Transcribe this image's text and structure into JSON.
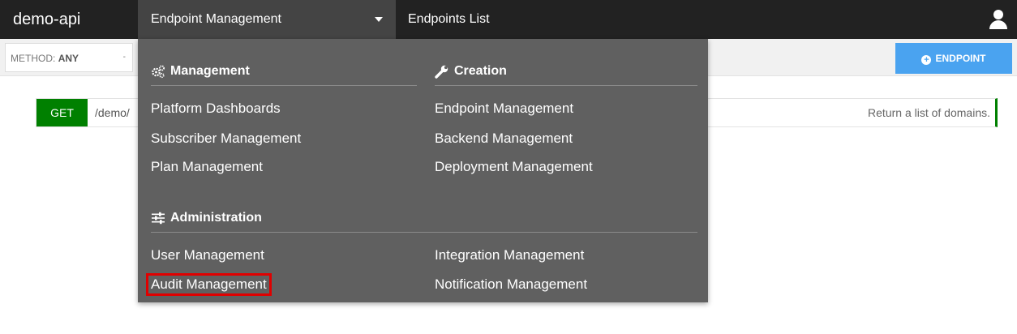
{
  "app": {
    "title": "demo-api"
  },
  "nav": {
    "dropdown_label": "Endpoint Management",
    "breadcrumb": "Endpoints List"
  },
  "toolbar": {
    "method_prefix": "METHOD:",
    "method_value": "ANY",
    "method_caret": "-",
    "endpoint_button": "ENDPOINT"
  },
  "endpoint": {
    "method": "GET",
    "path": "/demo/",
    "description": "Return a list of domains."
  },
  "menu": {
    "management": {
      "title": "Management",
      "items": [
        "Platform Dashboards",
        "Subscriber Management",
        "Plan Management"
      ]
    },
    "creation": {
      "title": "Creation",
      "items": [
        "Endpoint Management",
        "Backend Management",
        "Deployment Management"
      ]
    },
    "administration": {
      "title": "Administration",
      "left_items": [
        "User Management",
        "Audit Management"
      ],
      "right_items": [
        "Integration Management",
        "Notification Management"
      ]
    }
  },
  "colors": {
    "topbar": "#222222",
    "menu_bg": "#606060",
    "accent_blue": "#4aa3f0",
    "get_green": "#008000",
    "highlight_red": "#e00000"
  },
  "icons": [
    "user-icon",
    "cogs-icon",
    "wrench-icon",
    "sliders-icon",
    "plus-circle-icon"
  ]
}
